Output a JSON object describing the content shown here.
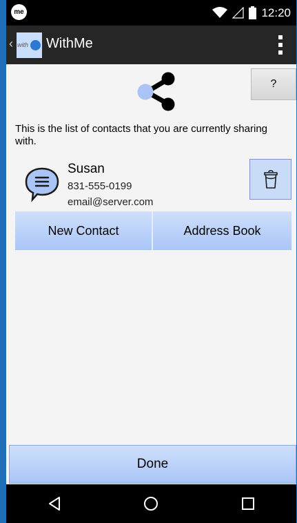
{
  "status_bar": {
    "app_icon_text": "me",
    "time": "12:20",
    "icons": [
      "wifi-icon",
      "signal-icon",
      "battery-icon"
    ]
  },
  "action_bar": {
    "logo_text": "with",
    "title": "WithMe",
    "back_glyph": "‹"
  },
  "help_button": {
    "label": "?"
  },
  "intro_text": "This is the list of contacts that you are currently sharing with.",
  "contact": {
    "name": "Susan",
    "phone": "831-555-0199",
    "email": "email@server.com"
  },
  "buttons": {
    "new_contact": "New Contact",
    "address_book": "Address Book",
    "done": "Done"
  },
  "nav": [
    "back-icon",
    "home-icon",
    "recents-icon"
  ],
  "colors": {
    "button_blue_top": "#cfdffc",
    "button_blue_bottom": "#a9c6f7",
    "share_dark": "#000000",
    "share_accent": "#a9c4f5",
    "action_bar": "#262626",
    "frame": "#1e6fb8"
  }
}
